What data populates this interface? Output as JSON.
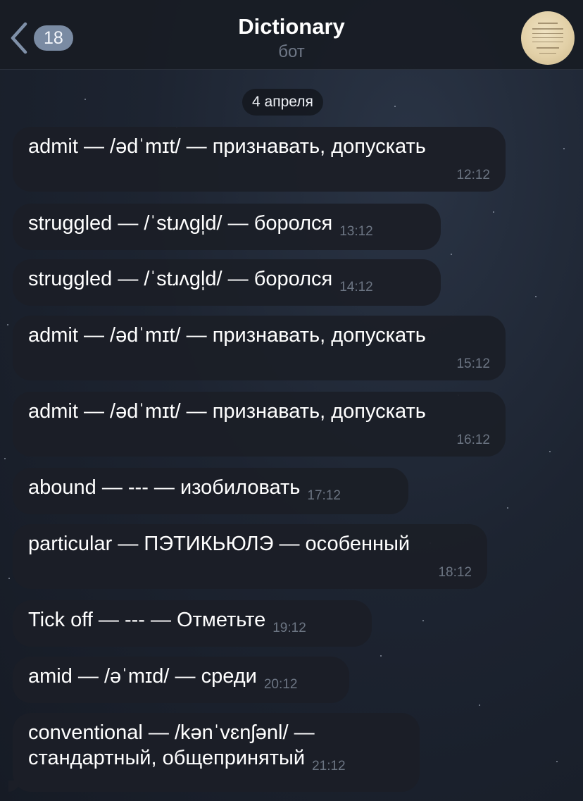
{
  "header": {
    "back_count": "18",
    "title": "Dictionary",
    "subtitle": "бот"
  },
  "date_chip": "4 апреля",
  "messages": [
    {
      "text": "admit — /ədˈmɪt/ — признавать, допускать",
      "time": "12:12"
    },
    {
      "text": "struggled — /ˈstɹʌɡl̩d/ — боролся",
      "time": "13:12"
    },
    {
      "text": "struggled — /ˈstɹʌɡl̩d/ — боролся",
      "time": "14:12"
    },
    {
      "text": "admit — /ədˈmɪt/ — признавать, допускать",
      "time": "15:12"
    },
    {
      "text": "admit — /ədˈmɪt/ — признавать, допускать",
      "time": "16:12"
    },
    {
      "text": "abound — --- — изобиловать",
      "time": "17:12"
    },
    {
      "text": "particular — ПЭТИКЬЮЛЭ — особенный",
      "time": "18:12"
    },
    {
      "text": "Tick off — --- — Отметьте",
      "time": "19:12"
    },
    {
      "text": "amid — /əˈmɪd/ — среди",
      "time": "20:12"
    },
    {
      "text_line1": "conventional — /kənˈvɛnʃənl/ —",
      "text_line2": "стандартный, общепринятый",
      "time": "21:12"
    }
  ],
  "colors": {
    "background": "#1d2431",
    "bubble": "#1b1f27",
    "accent": "#7a8ba3",
    "time": "#6c7583"
  }
}
